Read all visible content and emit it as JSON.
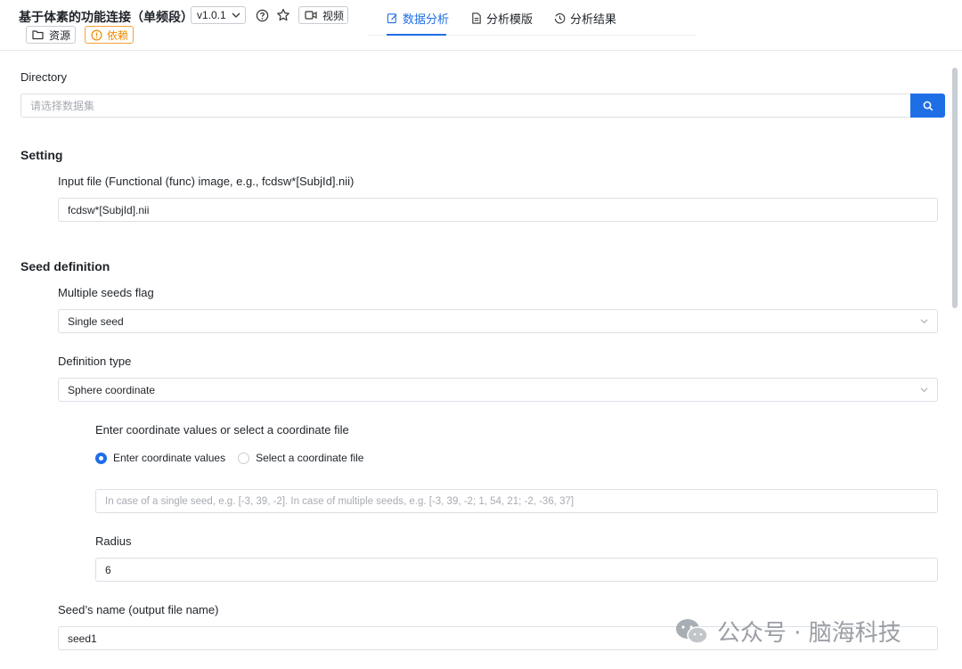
{
  "header": {
    "title": "基于体素的功能连接（单频段）",
    "version": "v1.0.1",
    "video_label": "视频",
    "resources_label": "资源",
    "dependency_label": "依赖",
    "tabs": [
      {
        "label": "数据分析",
        "icon": "edit-icon",
        "active": true
      },
      {
        "label": "分析模版",
        "icon": "document-icon",
        "active": false
      },
      {
        "label": "分析结果",
        "icon": "history-icon",
        "active": false
      }
    ]
  },
  "directory": {
    "label": "Directory",
    "placeholder": "请选择数据集"
  },
  "setting": {
    "heading": "Setting",
    "input_file_label": "Input file (Functional (func) image, e.g., fcdsw*[SubjId].nii)",
    "input_file_value": "fcdsw*[SubjId].nii"
  },
  "seed_definition": {
    "heading": "Seed definition",
    "multiple_seeds_label": "Multiple seeds flag",
    "multiple_seeds_value": "Single seed",
    "definition_type_label": "Definition type",
    "definition_type_value": "Sphere coordinate",
    "coordinate_prompt": "Enter coordinate values or select a coordinate file",
    "radio_enter": "Enter coordinate values",
    "radio_select": "Select a coordinate file",
    "coordinate_placeholder": "In case of a single seed, e.g. [-3, 39, -2]. In case of multiple seeds, e.g. [-3, 39, -2; 1, 54, 21; -2, -36, 37]",
    "radius_label": "Radius",
    "radius_value": "6",
    "seed_name_label": "Seed’s name (output file name)",
    "seed_name_value": "seed1"
  },
  "watermark": "公众号 · 脑海科技",
  "colors": {
    "accent": "#1e6fe6",
    "warning": "#f08c00",
    "border": "#dcdfe6"
  }
}
